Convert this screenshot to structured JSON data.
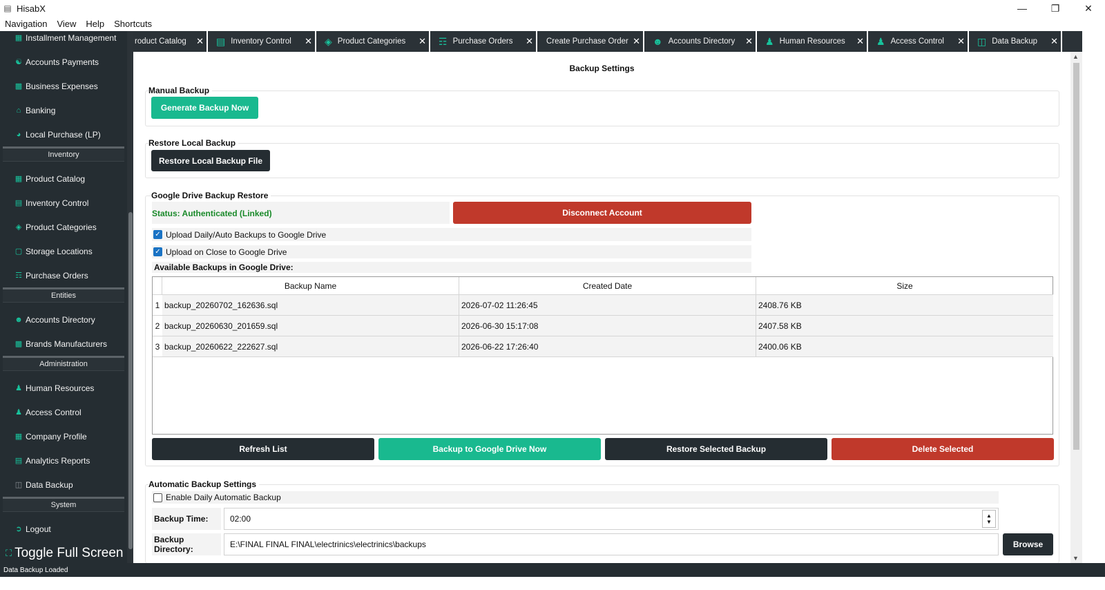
{
  "window": {
    "title": "HisabX"
  },
  "menu": [
    "Navigation",
    "View",
    "Help",
    "Shortcuts"
  ],
  "sidebar": {
    "items_top": [
      {
        "label": "Installment Management",
        "icon": "installment-icon"
      },
      {
        "label": "Accounts  Payments",
        "icon": "payments-icon"
      },
      {
        "label": "Business Expenses",
        "icon": "expenses-icon"
      },
      {
        "label": "Banking",
        "icon": "bank-icon"
      },
      {
        "label": "Local Purchase (LP)",
        "icon": "purchase-icon"
      }
    ],
    "section_inventory": "Inventory",
    "items_inventory": [
      {
        "label": "Product Catalog"
      },
      {
        "label": "Inventory Control"
      },
      {
        "label": "Product Categories"
      },
      {
        "label": "Storage Locations"
      },
      {
        "label": "Purchase Orders"
      }
    ],
    "section_entities": "Entities",
    "items_entities": [
      {
        "label": "Accounts Directory"
      },
      {
        "label": "Brands  Manufacturers"
      }
    ],
    "section_admin": "Administration",
    "items_admin": [
      {
        "label": "Human Resources"
      },
      {
        "label": "Access Control"
      },
      {
        "label": "Company Profile"
      },
      {
        "label": "Analytics  Reports"
      },
      {
        "label": "Data Backup"
      }
    ],
    "section_system": "System",
    "items_system": [
      {
        "label": "Logout"
      }
    ],
    "toggle_fullscreen": "Toggle Full Screen"
  },
  "tabs": [
    {
      "label": "roduct Catalog"
    },
    {
      "label": "Inventory Control"
    },
    {
      "label": "Product Categories"
    },
    {
      "label": "Purchase Orders"
    },
    {
      "label": "Create Purchase Order"
    },
    {
      "label": "Accounts Directory"
    },
    {
      "label": "Human Resources"
    },
    {
      "label": "Access Control"
    },
    {
      "label": "Data Backup"
    }
  ],
  "page": {
    "title": "Backup Settings",
    "manual": {
      "title": "Manual Backup",
      "button": "Generate Backup Now"
    },
    "restore": {
      "title": "Restore Local Backup",
      "button": "Restore Local Backup File"
    },
    "gdrive": {
      "title": "Google Drive Backup  Restore",
      "status": "Status: Authenticated (Linked)",
      "disconnect": "Disconnect Account",
      "opt_daily": "Upload Daily/Auto Backups to Google Drive",
      "opt_close": "Upload on Close to Google Drive",
      "available": "Available Backups in Google Drive:",
      "columns": [
        "Backup Name",
        "Created Date",
        "Size"
      ],
      "rows": [
        {
          "num": "1",
          "name": "backup_20260702_162636.sql",
          "date": "2026-07-02 11:26:45",
          "size": "2408.76 KB"
        },
        {
          "num": "2",
          "name": "backup_20260630_201659.sql",
          "date": "2026-06-30 15:17:08",
          "size": "2407.58 KB"
        },
        {
          "num": "3",
          "name": "backup_20260622_222627.sql",
          "date": "2026-06-22 17:26:40",
          "size": "2400.06 KB"
        }
      ],
      "btn_refresh": "Refresh List",
      "btn_backup": "Backup to Google Drive Now",
      "btn_restore": "Restore Selected Backup",
      "btn_delete": "Delete Selected"
    },
    "auto": {
      "title": "Automatic Backup Settings",
      "enable": "Enable Daily Automatic Backup",
      "time_label": "Backup Time:",
      "time_value": "02:00",
      "dir_label": "Backup Directory:",
      "dir_value": "E:\\FINAL FINAL FINAL\\electrinics\\electrinics\\backups",
      "browse": "Browse"
    }
  },
  "statusbar": "Data Backup Loaded",
  "colors": {
    "accent": "#19b98f",
    "dark": "#252d32",
    "danger": "#c0392b",
    "status_ok": "#1a8a2a"
  }
}
